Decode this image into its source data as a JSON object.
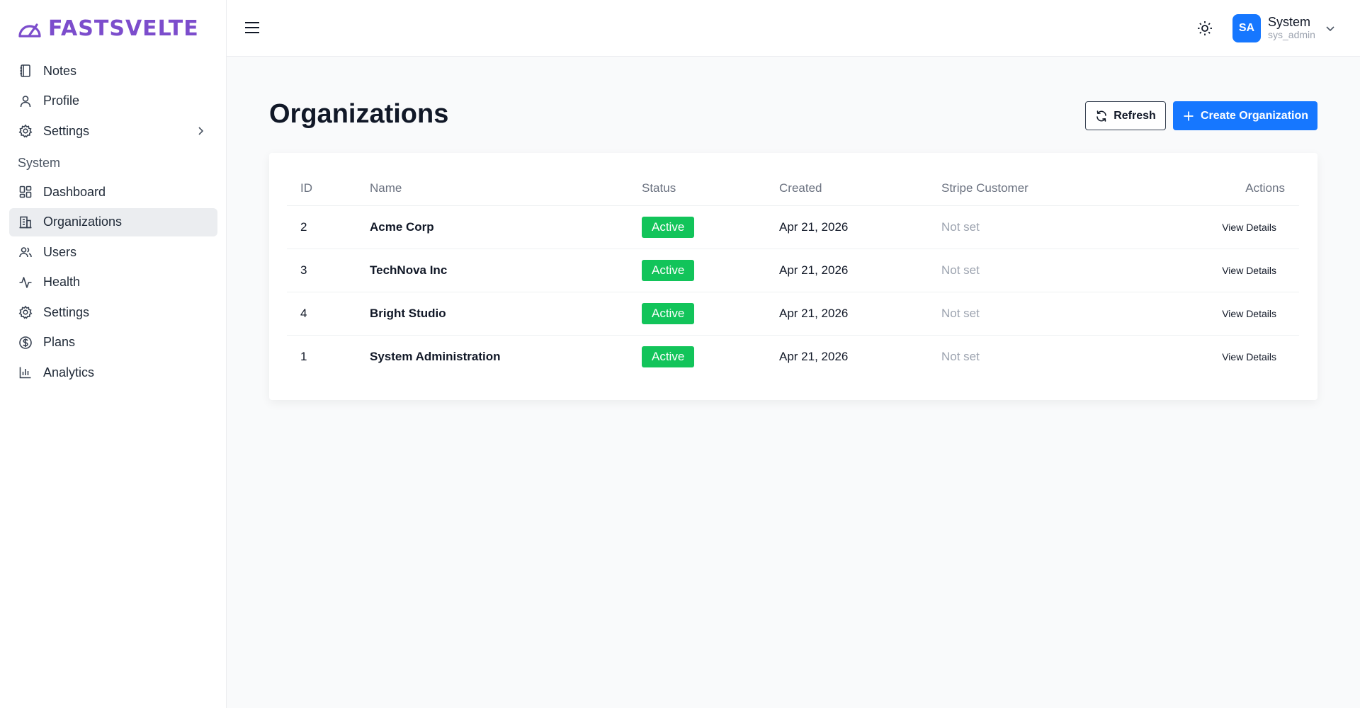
{
  "brand": {
    "name": "FASTSVELTE",
    "color": "#7c4dcc"
  },
  "sidebar": {
    "items": [
      {
        "label": "Notes",
        "icon": "notebook-icon"
      },
      {
        "label": "Profile",
        "icon": "user-icon"
      },
      {
        "label": "Settings",
        "icon": "gear-icon",
        "expandable": true
      }
    ],
    "section_label": "System",
    "system_items": [
      {
        "label": "Dashboard",
        "icon": "dashboard-icon"
      },
      {
        "label": "Organizations",
        "icon": "building-icon",
        "active": true
      },
      {
        "label": "Users",
        "icon": "users-icon"
      },
      {
        "label": "Health",
        "icon": "activity-icon"
      },
      {
        "label": "Settings",
        "icon": "gear-icon"
      },
      {
        "label": "Plans",
        "icon": "dollar-circle-icon"
      },
      {
        "label": "Analytics",
        "icon": "bar-chart-icon"
      }
    ]
  },
  "header": {
    "user": {
      "initials": "SA",
      "name": "System",
      "handle": "sys_admin"
    }
  },
  "main": {
    "title": "Organizations",
    "refresh_label": "Refresh",
    "create_label": "Create Organization",
    "table": {
      "columns": [
        "ID",
        "Name",
        "Status",
        "Created",
        "Stripe Customer",
        "Actions"
      ],
      "rows": [
        {
          "id": "2",
          "name": "Acme Corp",
          "status": "Active",
          "created": "Apr 21, 2026",
          "stripe": "Not set",
          "action": "View Details"
        },
        {
          "id": "3",
          "name": "TechNova Inc",
          "status": "Active",
          "created": "Apr 21, 2026",
          "stripe": "Not set",
          "action": "View Details"
        },
        {
          "id": "4",
          "name": "Bright Studio",
          "status": "Active",
          "created": "Apr 21, 2026",
          "stripe": "Not set",
          "action": "View Details"
        },
        {
          "id": "1",
          "name": "System Administration",
          "status": "Active",
          "created": "Apr 21, 2026",
          "stripe": "Not set",
          "action": "View Details"
        }
      ]
    }
  },
  "colors": {
    "primary": "#1677ff",
    "active_badge": "#12c45a"
  }
}
